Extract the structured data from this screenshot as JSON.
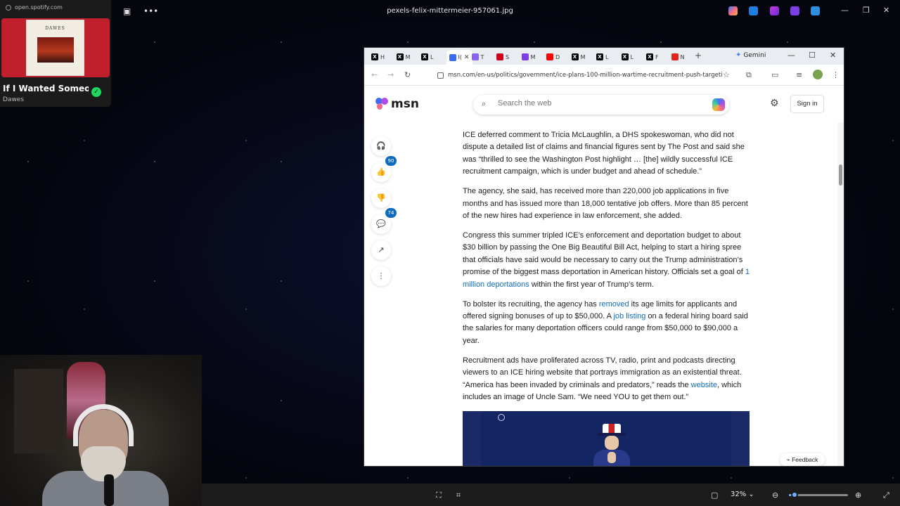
{
  "viewer": {
    "file_title": "pexels-felix-mittermeier-957061.jpg",
    "zoom": "32%",
    "zoom_fraction": 0.1
  },
  "spotify": {
    "url": "open.spotify.com",
    "album_band": "DAWES",
    "track": "If I Wanted Someone",
    "artist": "Dawes"
  },
  "browser": {
    "tabs": [
      {
        "label": "H",
        "icon": "x-icon",
        "color": "#000000"
      },
      {
        "label": "M",
        "icon": "x-icon",
        "color": "#000000"
      },
      {
        "label": "L",
        "icon": "x-icon",
        "color": "#000000"
      },
      {
        "label": "I(",
        "icon": "msn-icon",
        "color": "#3b6ef5"
      },
      {
        "label": "T",
        "icon": "bluesky-icon",
        "color": "#8a63f0"
      },
      {
        "label": "S",
        "icon": "app-icon",
        "color": "#d0021b"
      },
      {
        "label": "M",
        "icon": "app-icon",
        "color": "#7b3fe4"
      },
      {
        "label": "D",
        "icon": "youtube-icon",
        "color": "#ff0000"
      },
      {
        "label": "M",
        "icon": "x-icon",
        "color": "#000000"
      },
      {
        "label": "L",
        "icon": "x-icon",
        "color": "#000000"
      },
      {
        "label": "L",
        "icon": "x-icon",
        "color": "#000000"
      },
      {
        "label": "F",
        "icon": "x-icon",
        "color": "#000000"
      },
      {
        "label": "N",
        "icon": "app-icon",
        "color": "#e2231a"
      }
    ],
    "gemini_label": "Gemini",
    "url": "msn.com/en-us/politics/government/ice-plans-100-million-wartime-recruitment-push-targetin..."
  },
  "msn": {
    "logo_text": "msn",
    "search_placeholder": "Search the web",
    "signin_label": "Sign in",
    "like_count": "90",
    "comment_count": "74",
    "feedback_label": "Feedback"
  },
  "article": {
    "p1": "ICE deferred comment to Tricia McLaughlin, a DHS spokeswoman, who did not dispute a detailed list of claims and financial figures sent by The Post and said she was “thrilled to see the Washington Post highlight … [the] wildly successful ICE recruitment campaign, which is under budget and ahead of schedule.”",
    "p2": "The agency, she said, has received more than 220,000 job applications in five months and has issued more than 18,000 tentative job offers. More than 85 percent of the new hires had experience in law enforcement, she added.",
    "p3_before": "Congress this summer tripled ICE’s enforcement and deportation budget to about $30 billion by passing the One Big Beautiful Bill Act, helping to start a hiring spree that officials have said would be necessary to carry out the Trump administration’s promise of the biggest mass deportation in American history. Officials set a goal of ",
    "p3_link": "1 million deportations",
    "p3_after": " within the first year of Trump’s term.",
    "p4_a": "To bolster its recruiting, the agency has ",
    "p4_link1": "removed",
    "p4_b": " its age limits for applicants and offered signing bonuses of up to $50,000. A ",
    "p4_link2": "job listing",
    "p4_c": " on a federal hiring board said the salaries for many deportation officers could range from $50,000 to $90,000 a year.",
    "p5_a": "Recruitment ads have proliferated across TV, radio, print and podcasts directing viewers to an ICE hiring website that portrays immigration as an existential threat. “America has been invaded by criminals and predators,” reads the ",
    "p5_link": "website",
    "p5_b": ", which includes an image of Uncle Sam. “We need YOU to get them out.”"
  }
}
